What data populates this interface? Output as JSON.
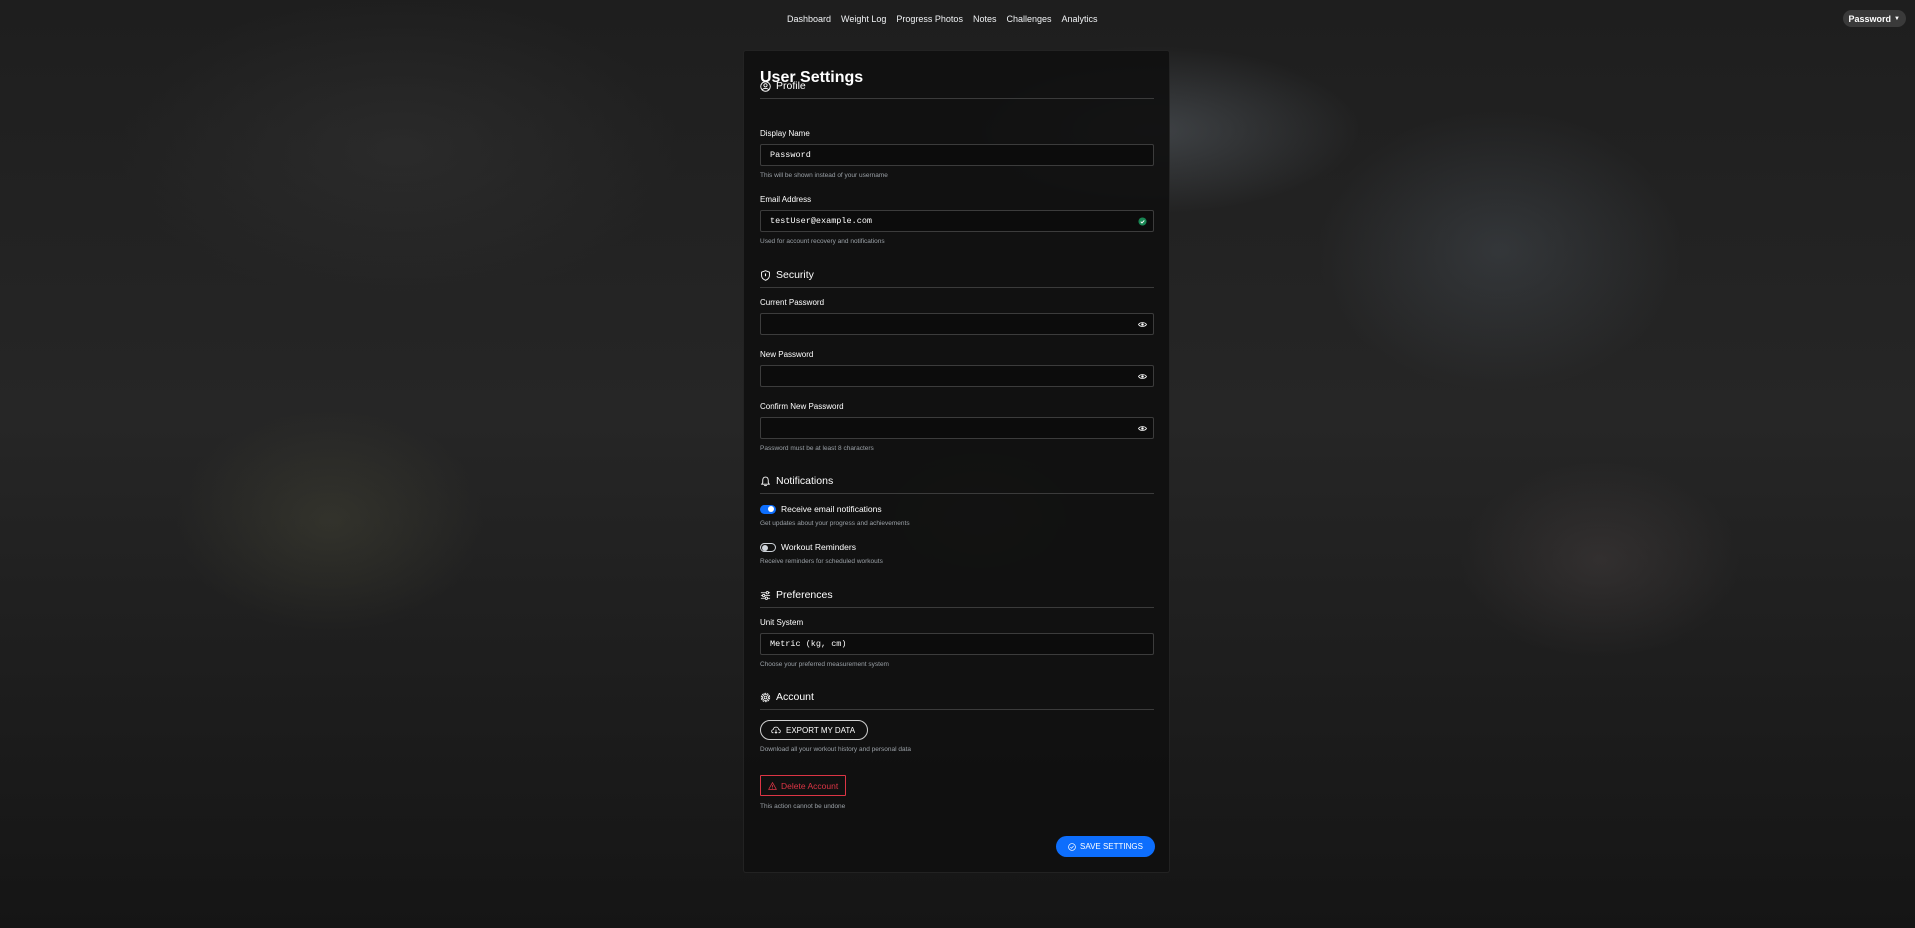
{
  "nav": {
    "links": [
      "Dashboard",
      "Weight Log",
      "Progress Photos",
      "Notes",
      "Challenges",
      "Analytics"
    ],
    "user_label": "Password"
  },
  "page": {
    "title": "User Settings"
  },
  "profile": {
    "heading": "Profile",
    "display_name": {
      "label": "Display Name",
      "value": "Password",
      "help": "This will be shown instead of your username"
    },
    "email": {
      "label": "Email Address",
      "value": "testUser@example.com",
      "help": "Used for account recovery and notifications",
      "status_icon": "check-circle-icon"
    }
  },
  "security": {
    "heading": "Security",
    "current_password": {
      "label": "Current Password",
      "value": ""
    },
    "new_password": {
      "label": "New Password",
      "value": ""
    },
    "confirm_password": {
      "label": "Confirm New Password",
      "value": "",
      "help": "Password must be at least 8 characters"
    }
  },
  "notifications": {
    "heading": "Notifications",
    "email_notifications": {
      "label": "Receive email notifications",
      "help": "Get updates about your progress and achievements",
      "enabled": true
    },
    "workout_reminders": {
      "label": "Workout Reminders",
      "help": "Receive reminders for scheduled workouts",
      "enabled": false
    }
  },
  "preferences": {
    "heading": "Preferences",
    "unit_system": {
      "label": "Unit System",
      "value": "Metric (kg, cm)",
      "help": "Choose your preferred measurement system"
    }
  },
  "account": {
    "heading": "Account",
    "export_label": "EXPORT MY DATA",
    "export_help": "Download all your workout history and personal data",
    "delete_label": "Delete Account",
    "delete_help": "This action cannot be undone"
  },
  "save_label": "SAVE SETTINGS",
  "colors": {
    "accent": "#0d6efd",
    "danger": "#dc3545",
    "success": "#198754"
  }
}
